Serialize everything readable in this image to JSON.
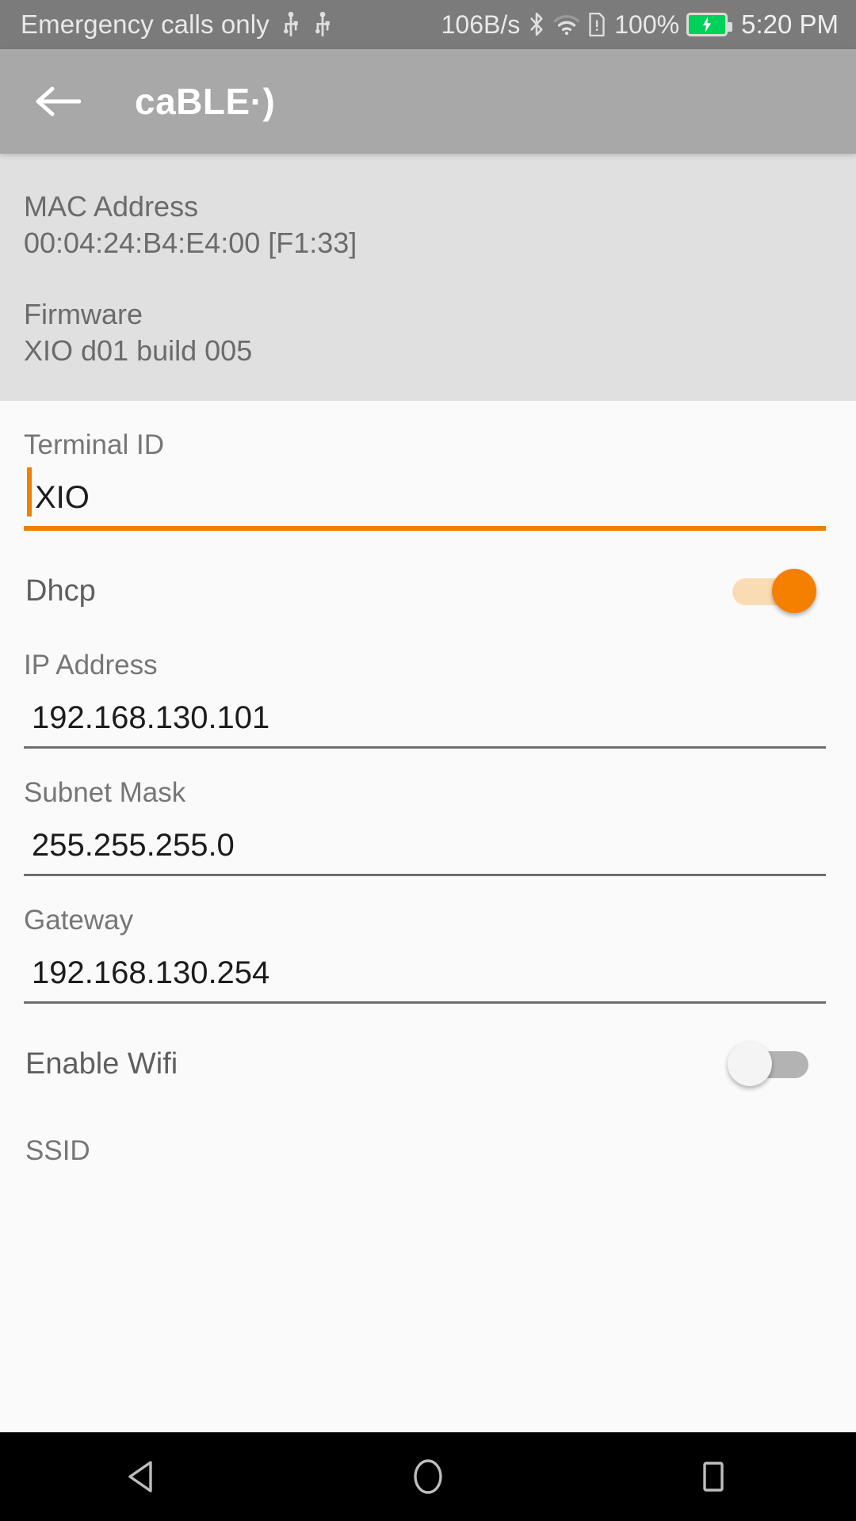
{
  "status_bar": {
    "carrier": "Emergency calls only",
    "net_speed": "106B/s",
    "battery_percent": "100%",
    "clock": "5:20 PM",
    "icons": [
      "usb-icon",
      "usb-icon",
      "bluetooth-icon",
      "wifi-icon",
      "sim-alert-icon",
      "battery-charging-icon"
    ]
  },
  "app_bar": {
    "title": "caBLE·)",
    "back_icon": "back-arrow-icon"
  },
  "device_info": [
    {
      "label": "MAC Address",
      "value": "00:04:24:B4:E4:00 [F1:33]"
    },
    {
      "label": "Firmware",
      "value": "XIO d01 build 005"
    }
  ],
  "form": {
    "terminal_id": {
      "label": "Terminal ID",
      "value": "XIO",
      "focused": true
    },
    "dhcp": {
      "label": "Dhcp",
      "state": "on"
    },
    "ip_address": {
      "label": "IP Address",
      "value": "192.168.130.101"
    },
    "subnet_mask": {
      "label": "Subnet Mask",
      "value": "255.255.255.0"
    },
    "gateway": {
      "label": "Gateway",
      "value": "192.168.130.254"
    },
    "enable_wifi": {
      "label": "Enable Wifi",
      "state": "off"
    },
    "ssid": {
      "label": "SSID"
    }
  },
  "nav_bar": {
    "back": "nav-back-icon",
    "home": "nav-home-icon",
    "recents": "nav-recents-icon"
  },
  "colors": {
    "accent": "#f58000",
    "app_bar": "#a8a8a8",
    "status_bar": "#7b7b7b",
    "info_panel": "#e0e0e0",
    "page_bg": "#fafafa",
    "battery_green": "#00d15a"
  }
}
